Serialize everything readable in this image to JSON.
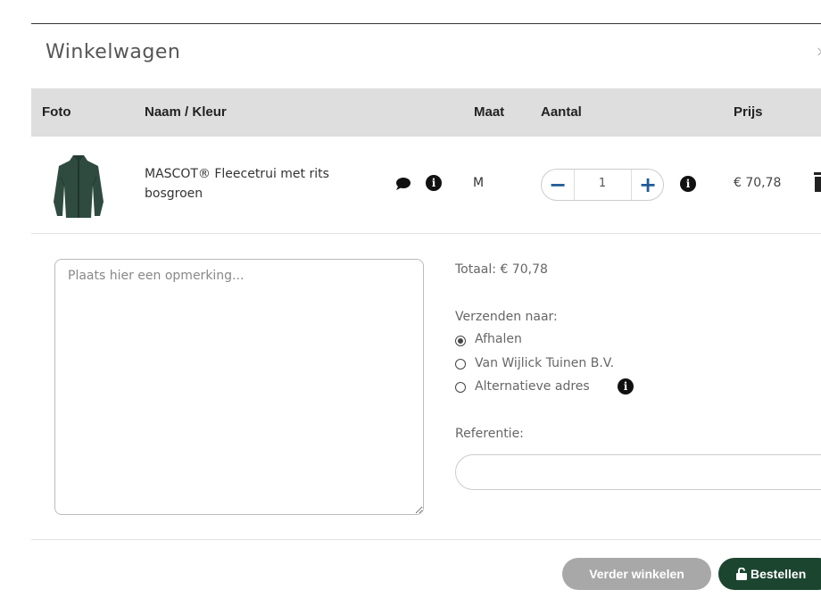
{
  "modal": {
    "title": "Winkelwagen",
    "close_glyph": "×"
  },
  "table": {
    "headers": {
      "foto": "Foto",
      "naam": "Naam / Kleur",
      "maat": "Maat",
      "aantal": "Aantal",
      "prijs": "Prijs"
    },
    "rows": [
      {
        "name": "MASCOT® Fleecetrui met rits",
        "color": "bosgroen",
        "size": "M",
        "quantity": "1",
        "price": "€ 70,78",
        "icons": [
          "comment-icon",
          "info-icon",
          "minus-icon",
          "plus-icon",
          "info-icon",
          "trash-icon"
        ]
      }
    ]
  },
  "remark": {
    "placeholder": "Plaats hier een opmerking..."
  },
  "summary": {
    "total": "Totaal: € 70,78",
    "ship_label": "Verzenden naar:",
    "ship_options": [
      {
        "label": "Afhalen",
        "selected": true
      },
      {
        "label": "Van Wijlick Tuinen B.V.",
        "selected": false
      },
      {
        "label": "Alternatieve adres",
        "selected": false
      }
    ],
    "reference_label": "Referentie:",
    "reference_value": ""
  },
  "buttons": {
    "continue": "Verder winkelen",
    "order": "Bestellen",
    "order_icon": "unlock-icon"
  },
  "colors": {
    "accent_blue": "#1f5c95",
    "order_green": "#1c4530",
    "header_grey": "#dedede",
    "button_grey": "#a8a8a8"
  }
}
